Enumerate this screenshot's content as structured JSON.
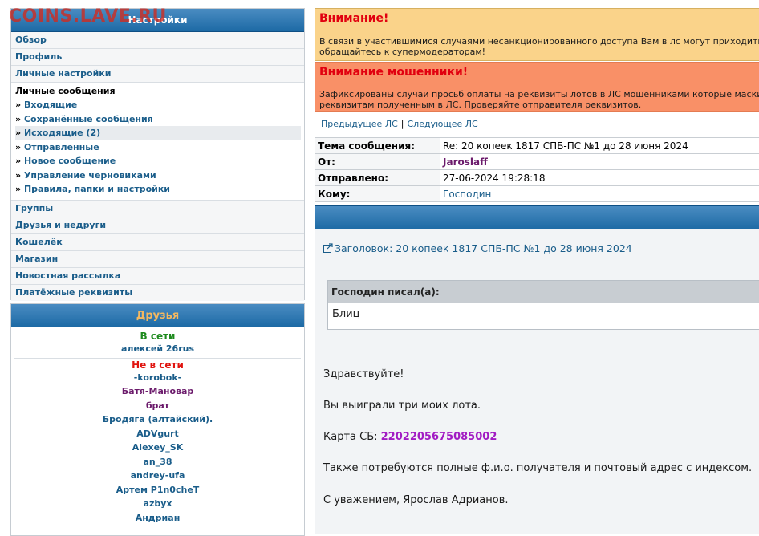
{
  "watermark": "COINS.LAVE.RU",
  "settings": {
    "title": "Настройки",
    "items_top": [
      "Обзор",
      "Профиль",
      "Личные настройки"
    ],
    "pm_title": "Личные сообщения",
    "pm_items": [
      "Входящие",
      "Сохранённые сообщения",
      "Исходящие (2)",
      "Отправленные",
      "Новое сообщение",
      "Управление черновиками",
      "Правила, папки и настройки"
    ],
    "bullet": "»",
    "items_bottom": [
      "Группы",
      "Друзья и недруги",
      "Кошелёк",
      "Магазин",
      "Новостная рассылка",
      "Платёжные реквизиты"
    ]
  },
  "friends": {
    "title": "Друзья",
    "online_label": "В сети",
    "online": [
      "алексей 26rus"
    ],
    "offline_label": "Не в сети",
    "offline": [
      "-korobok-",
      "Батя-Мановар",
      "брат",
      "Бродяга (алтайский).",
      "ADVgurt",
      "Alexey_SK",
      "an_38",
      "andrey-ufa",
      "Артем P1n0cheT",
      "azbyx",
      "Андриан"
    ]
  },
  "alerts": [
    {
      "title": "Внимание!",
      "line1": "В связи в участившимися случаями несанкционированного доступа Вам в лс могут приходить",
      "line2": "обращайтесь к супермодераторам!"
    },
    {
      "title": "Внимание мошенники!",
      "line1": "Зафиксированы случаи просьб оплаты на реквизиты лотов в ЛС мошенниками которые маскир",
      "line2": "реквизитам полученным в ЛС. Проверяйте отправителя реквизитов."
    }
  ],
  "pmnav": {
    "prev": "Предыдущее ЛС",
    "sep": "|",
    "next": "Следующее ЛС"
  },
  "meta": {
    "subject_label": "Тема сообщения:",
    "subject": "Re: 20 копеек 1817 СПБ-ПС №1 до 28 июня 2024",
    "from_label": "От:",
    "from": "Jaroslaff",
    "sent_label": "Отправлено:",
    "sent": "27-06-2024 19:28:18",
    "to_label": "Кому:",
    "to": "Господин"
  },
  "message": {
    "subject": "Заголовок: 20 копеек 1817 СПБ-ПС №1 до 28 июня 2024",
    "quote_head": "Господин писал(а):",
    "quote_body": "Блиц",
    "greeting": "Здравствуйте!",
    "line2": "Вы выиграли три моих лота.",
    "card_label": "Карта СБ:",
    "card_number": "2202205675085002",
    "line4": "Также потребуются полные ф.и.о. получателя и почтовый адрес с индексом.",
    "signoff": "С уважением, Ярослав Адрианов."
  },
  "colors": {
    "header_blue": "#1d6aa5",
    "link_blue": "#1a5d8a",
    "alert_yellow": "#fad38a",
    "alert_orange": "#f99067",
    "alert_red_text": "#e1000f",
    "online_green": "#1d8a1d",
    "offline_red": "#e0140f",
    "username_purple": "#6b1a6b",
    "card_purple": "#a21cc3"
  }
}
